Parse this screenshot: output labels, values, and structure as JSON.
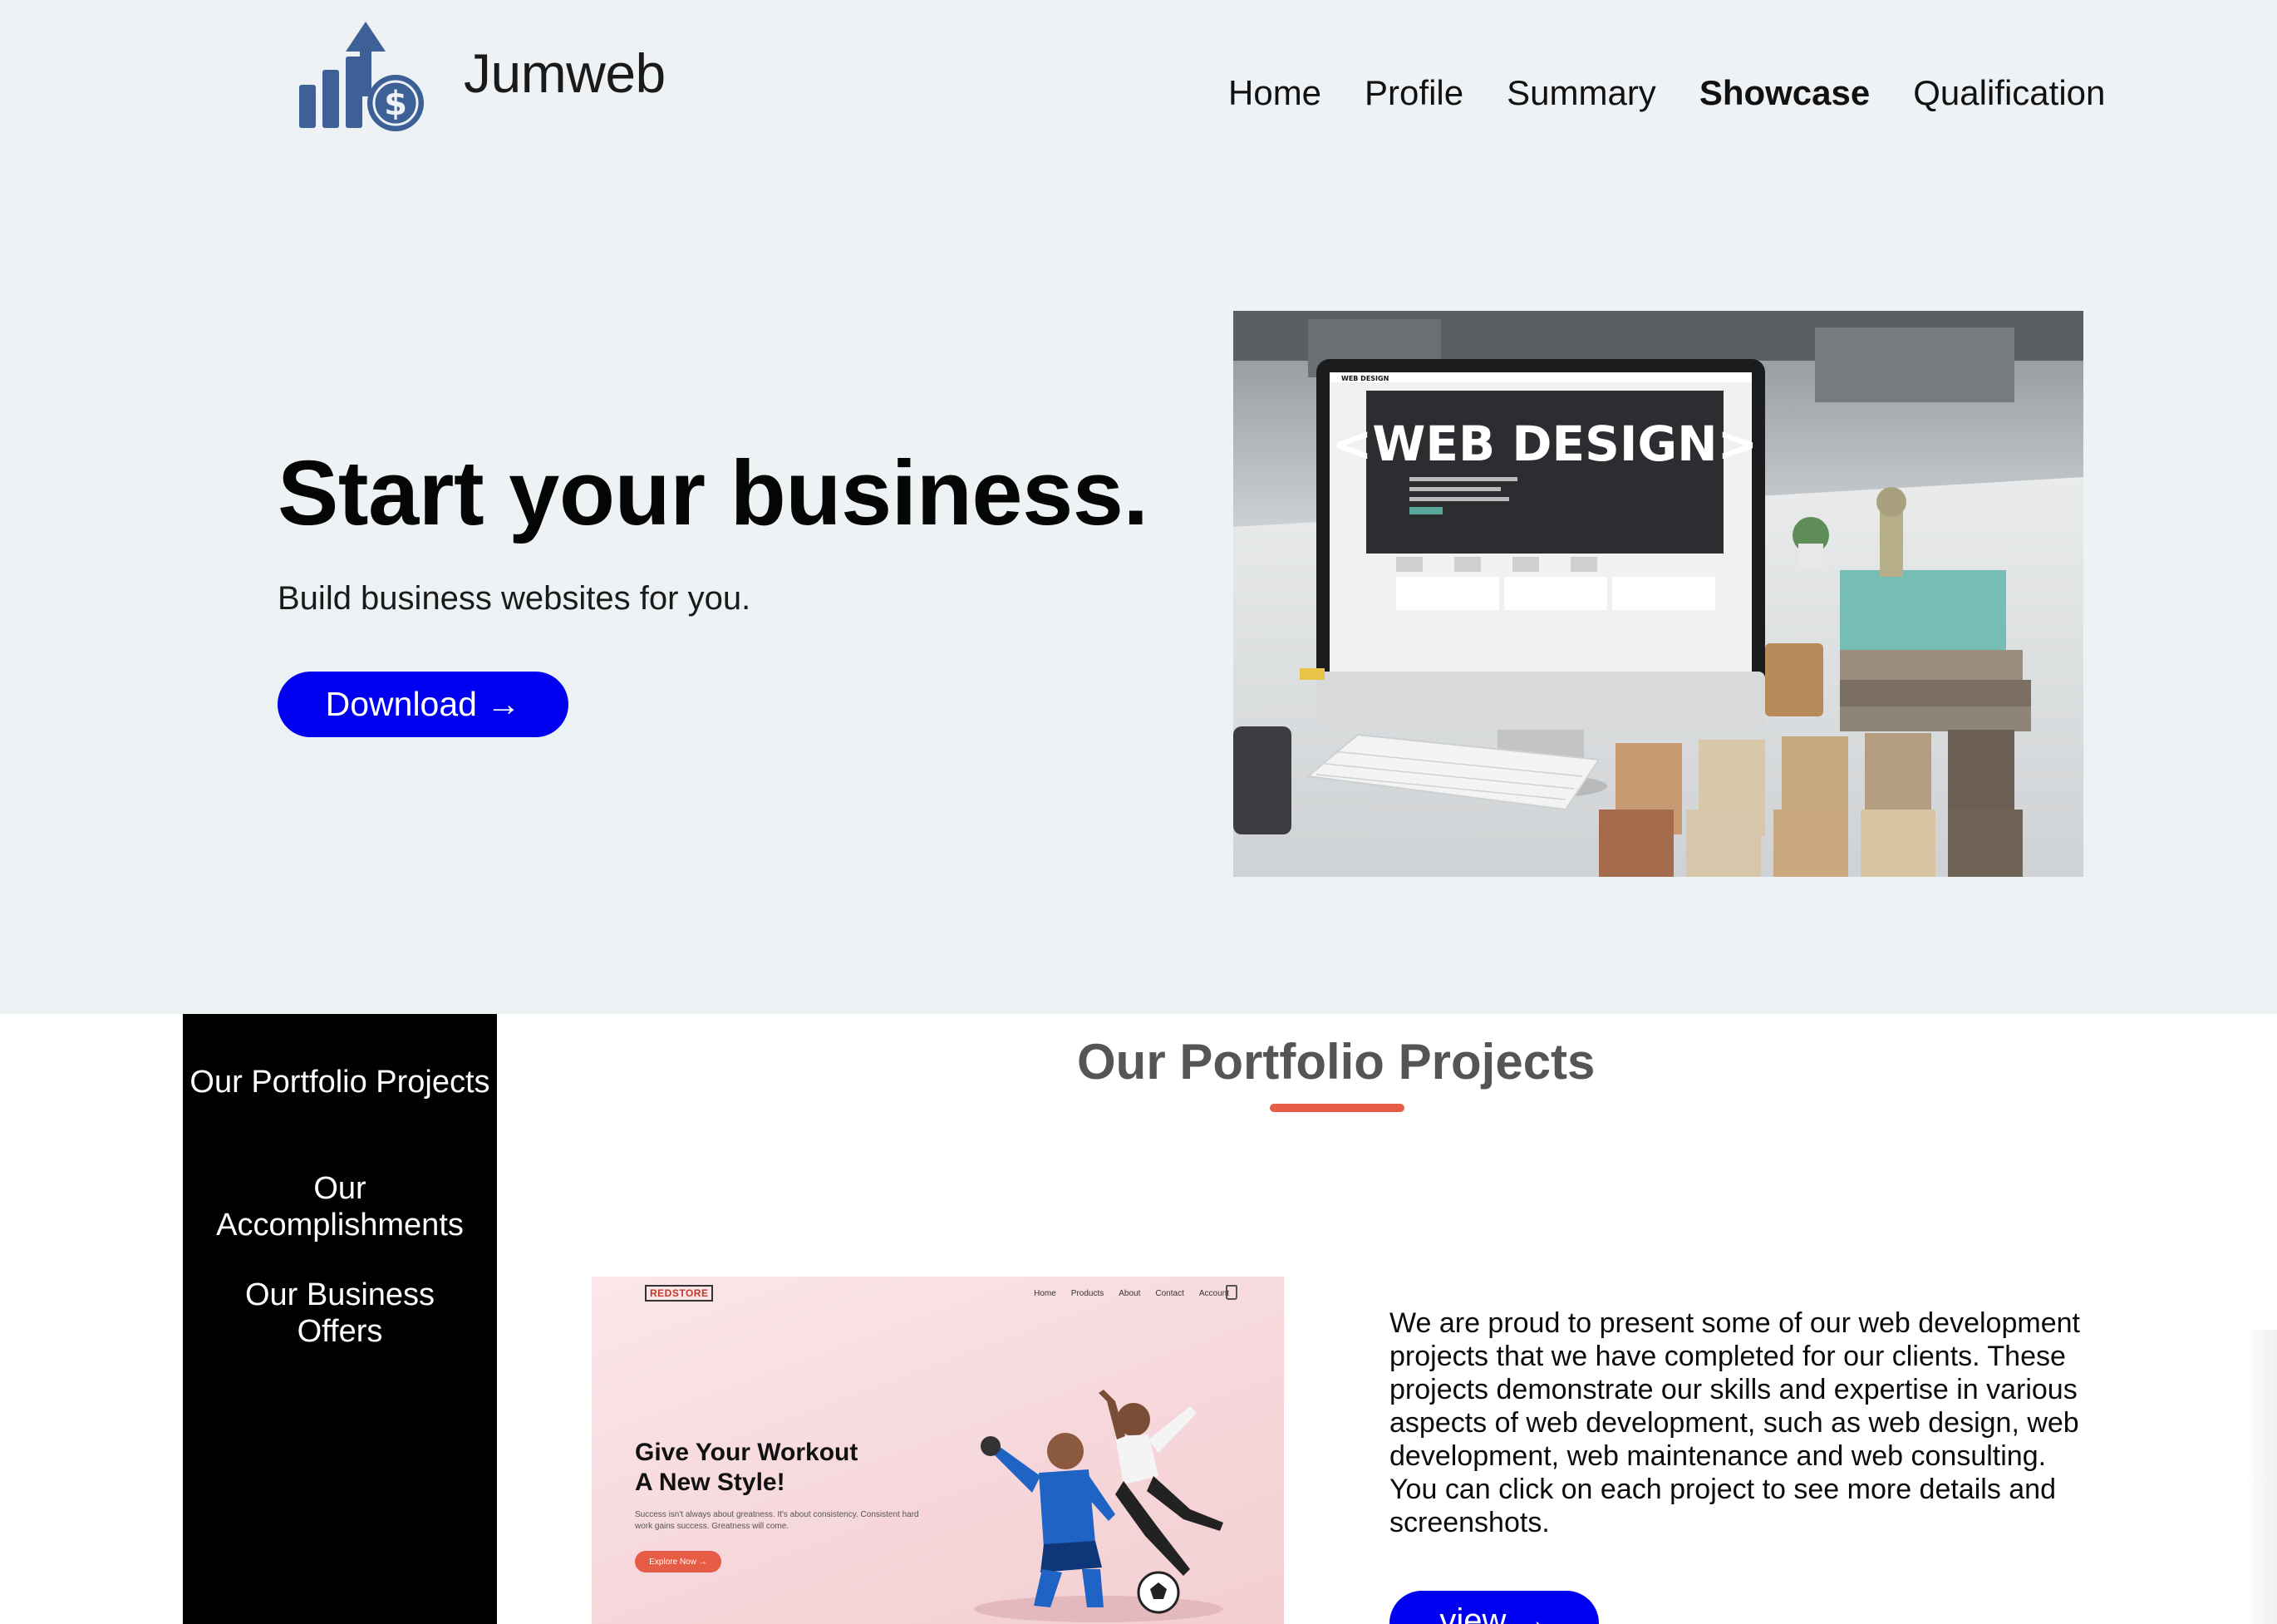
{
  "brand": {
    "name": "Jumweb",
    "logo_icon": "growth-chart-dollar-icon",
    "logo_color": "#3d6196"
  },
  "nav": {
    "items": [
      "Home",
      "Profile",
      "Summary",
      "Showcase",
      "Qualification"
    ],
    "active": "Showcase"
  },
  "hero": {
    "title": "Start your business.",
    "subtitle": "Build business websites for you.",
    "button_label": "Download →",
    "button_color": "#0000f0",
    "image": {
      "screen_heading": "<WEB DESIGN>",
      "screen_brand": "WEB DESIGN"
    }
  },
  "sidebar": {
    "items": [
      "Our Portfolio Projects",
      "Our Accomplishments",
      "Our Business Offers"
    ]
  },
  "portfolio": {
    "title": "Our Portfolio Projects",
    "underline_color": "#e65c45",
    "description": "We are proud to present some of our web development projects that we have completed for our clients. These projects demonstrate our skills and expertise in various aspects of web development, such as web design, web development, web maintenance and web consulting. You can click on each project to see more details and screenshots.",
    "view_label": "view →",
    "project": {
      "logo": "REDSTORE",
      "nav": [
        "Home",
        "Products",
        "About",
        "Contact",
        "Account"
      ],
      "heading_line1": "Give Your Workout",
      "heading_line2": "A New Style!",
      "copy": "Success isn't always about greatness. It's about consistency. Consistent hard work gains success. Greatness will come.",
      "button": "Explore Now →"
    }
  }
}
